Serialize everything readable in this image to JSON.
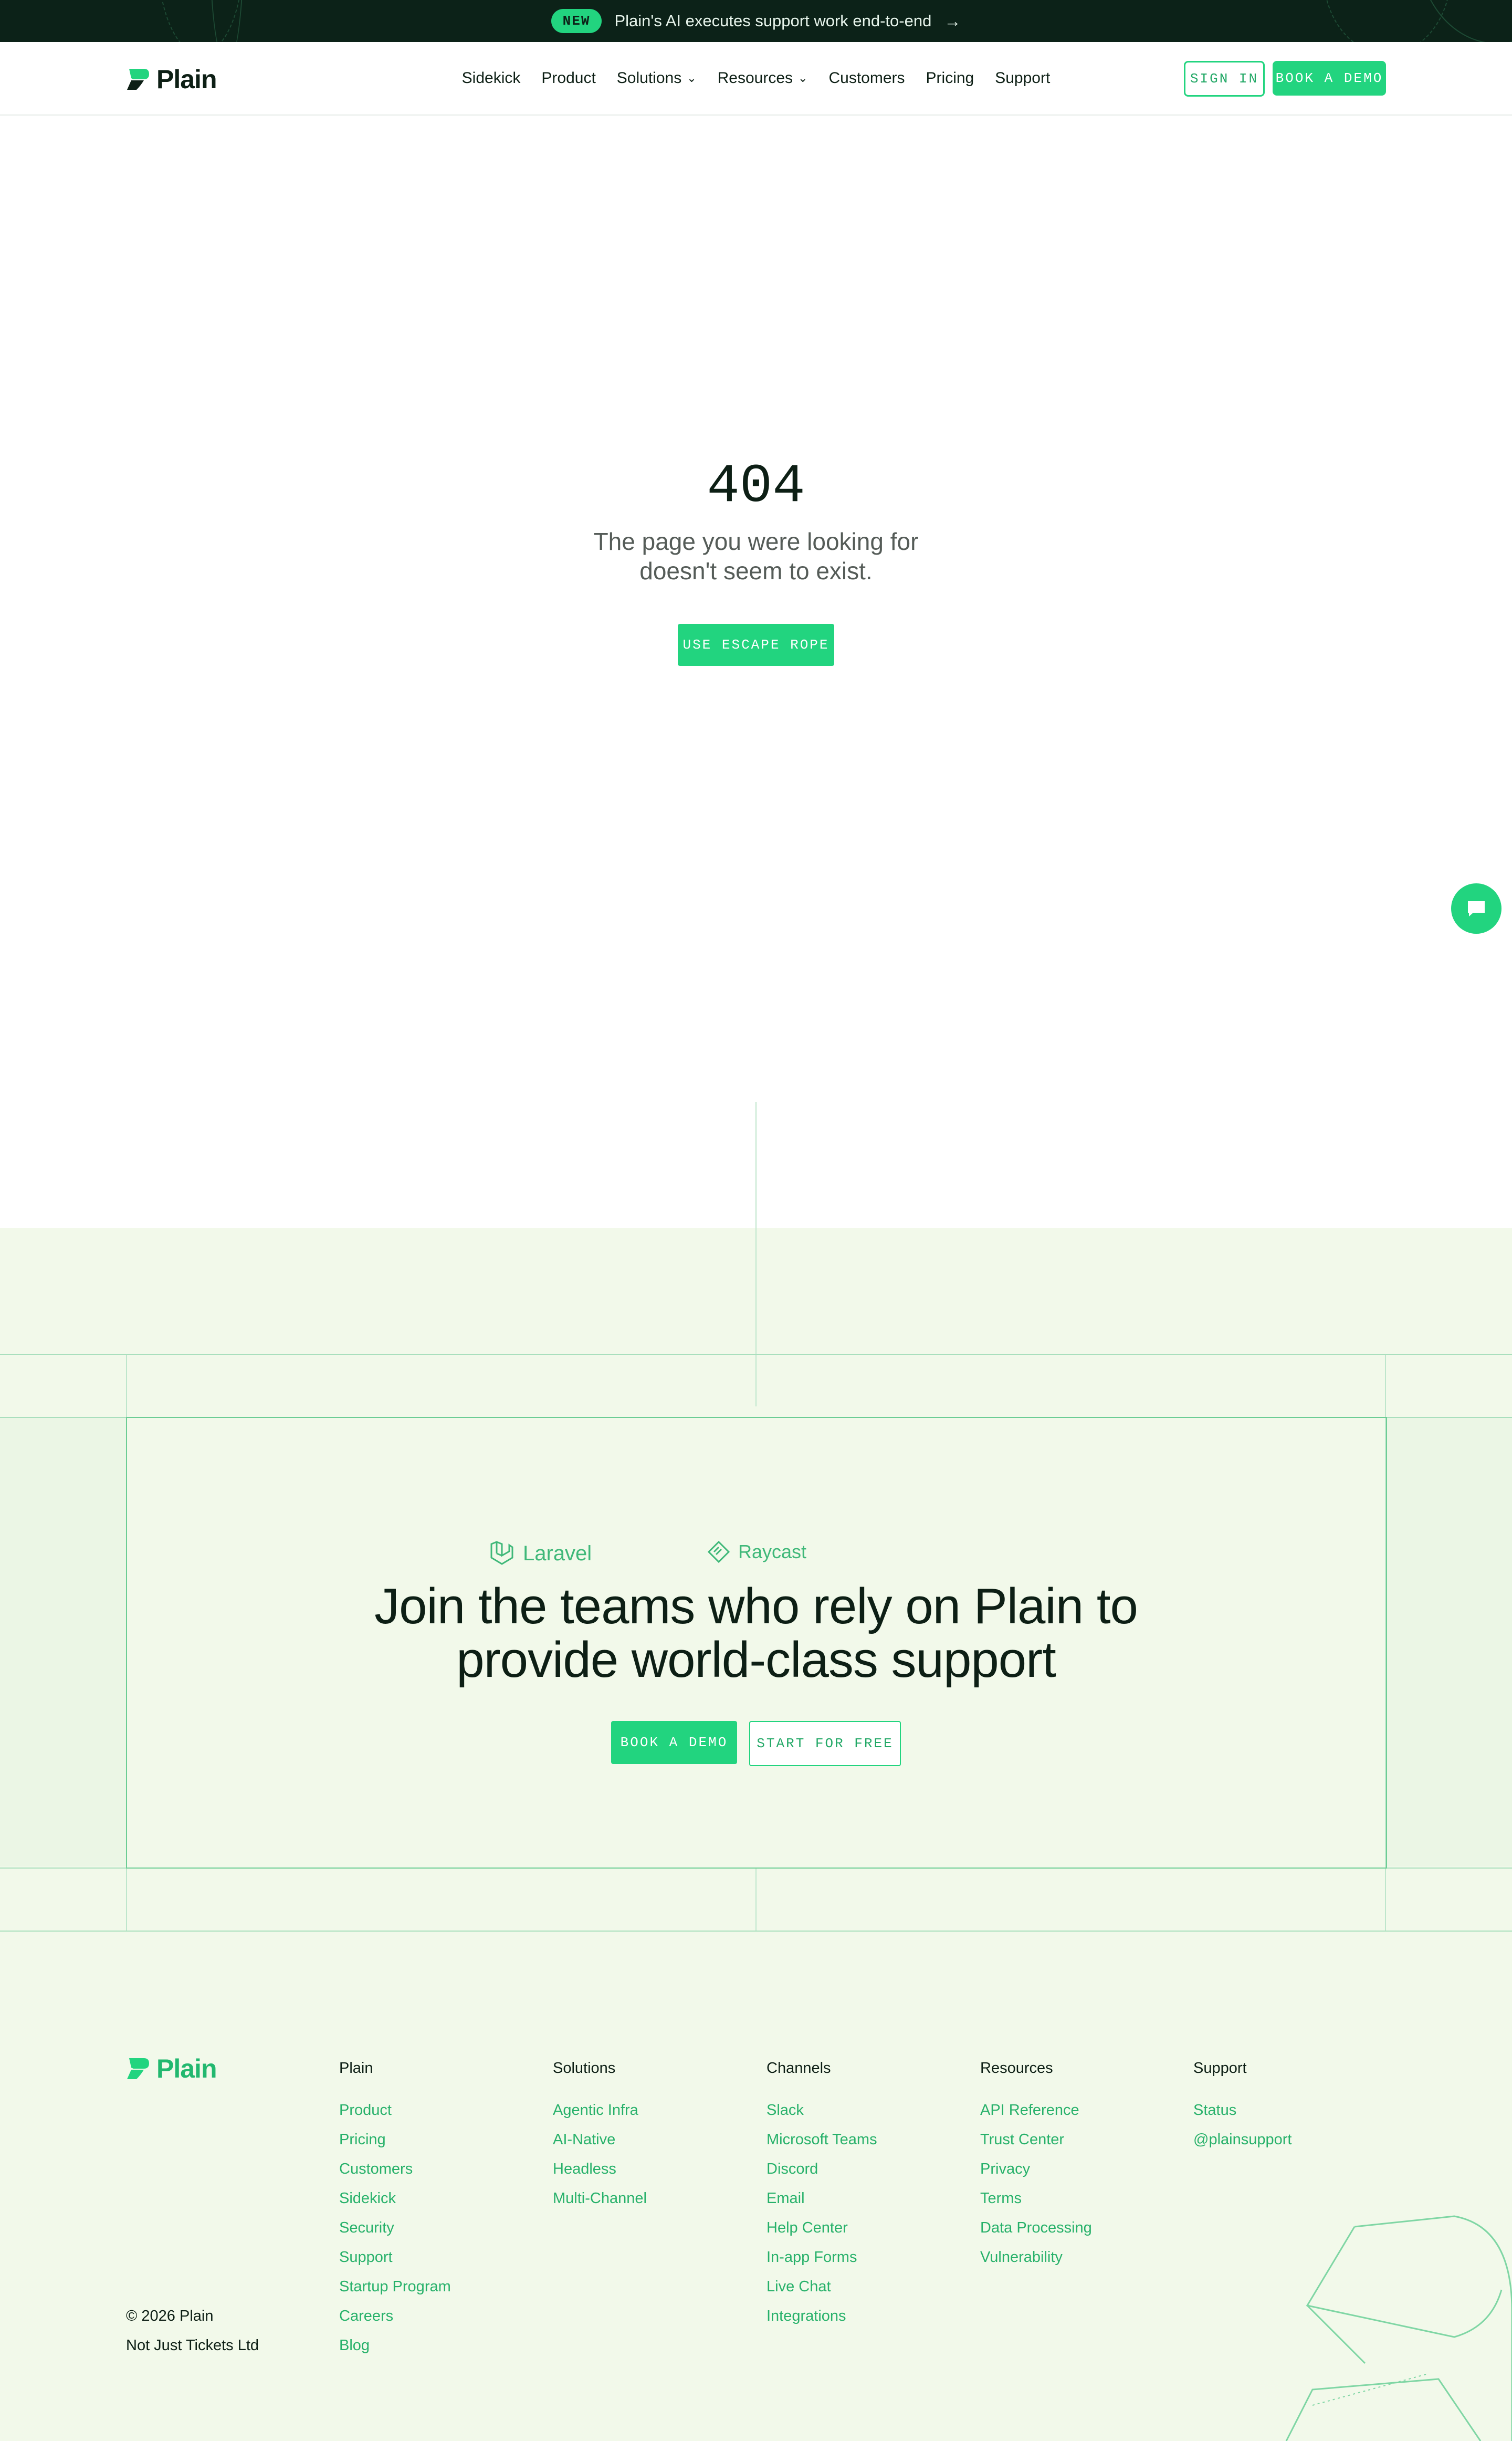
{
  "announcement": {
    "badge": "NEW",
    "text": "Plain's AI executes support work end-to-end",
    "arrow": "→"
  },
  "header": {
    "logo_text": "Plain",
    "nav": [
      {
        "label": "Sidekick",
        "has_dropdown": false
      },
      {
        "label": "Product",
        "has_dropdown": false
      },
      {
        "label": "Solutions",
        "has_dropdown": true
      },
      {
        "label": "Resources",
        "has_dropdown": true
      },
      {
        "label": "Customers",
        "has_dropdown": false
      },
      {
        "label": "Pricing",
        "has_dropdown": false
      },
      {
        "label": "Support",
        "has_dropdown": false
      }
    ],
    "sign_in": "SIGN IN",
    "book_demo": "BOOK A DEMO"
  },
  "error": {
    "code": "404",
    "message": "The page you were looking for doesn't seem to exist.",
    "button": "USE ESCAPE ROPE"
  },
  "chat": {
    "icon": "chat-bubble-icon"
  },
  "cta": {
    "logos": [
      "Laravel",
      "Raycast"
    ],
    "title": "Join the teams who rely on Plain to provide world-class support",
    "primary": "BOOK A DEMO",
    "secondary": "START FOR FREE"
  },
  "footer": {
    "logo_text": "Plain",
    "copyright": "© 2026 Plain",
    "company": "Not Just Tickets Ltd",
    "columns": [
      {
        "heading": "Plain",
        "links": [
          "Product",
          "Pricing",
          "Customers",
          "Sidekick",
          "Security",
          "Support",
          "Startup Program",
          "Careers",
          "Blog"
        ]
      },
      {
        "heading": "Solutions",
        "links": [
          "Agentic Infra",
          "AI-Native",
          "Headless",
          "Multi-Channel"
        ]
      },
      {
        "heading": "Channels",
        "links": [
          "Slack",
          "Microsoft Teams",
          "Discord",
          "Email",
          "Help Center",
          "In-app Forms",
          "Live Chat",
          "Integrations"
        ]
      },
      {
        "heading": "Resources",
        "links": [
          "API Reference",
          "Trust Center",
          "Privacy",
          "Terms",
          "Data Processing",
          "Vulnerability"
        ]
      },
      {
        "heading": "Support",
        "links": [
          "Status",
          "@plainsupport"
        ]
      }
    ]
  },
  "colors": {
    "brand_green": "#22d47f",
    "dark": "#0c2218",
    "link_green": "#27b16a",
    "section_bg": "#f2f9ea"
  }
}
